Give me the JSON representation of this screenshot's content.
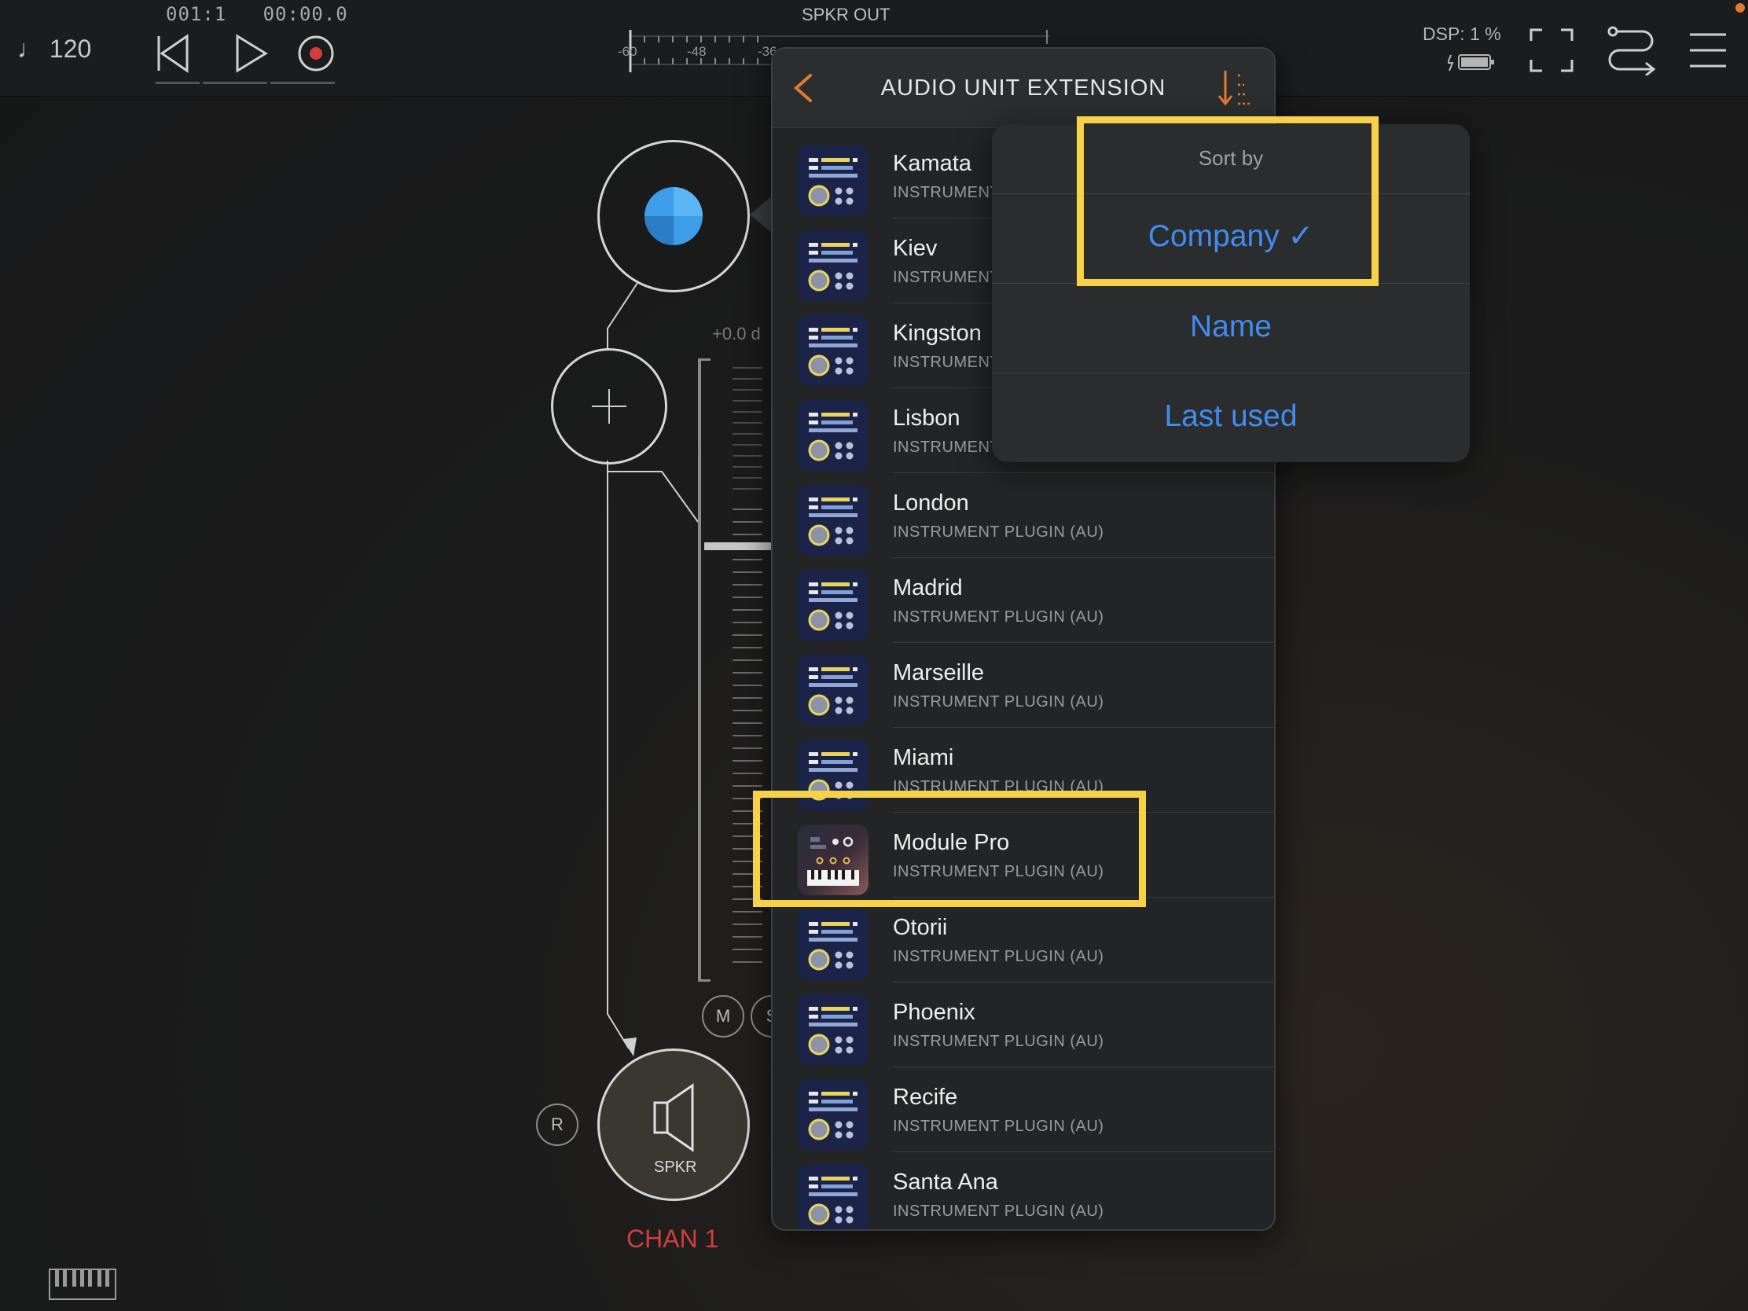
{
  "topbar": {
    "tempo": "♩ 120",
    "position": "001:1",
    "time": "00:00.0",
    "meter_label": "SPKR OUT",
    "meter_ticks": [
      "-60",
      "-48",
      "-36"
    ],
    "meter_peak": "-∞",
    "dsp_label": "DSP:",
    "dsp_value": "1 %"
  },
  "graph": {
    "gain_readout": "+0.0 d",
    "mute_label": "M",
    "solo_label": "S",
    "record_label": "R",
    "speaker_label": "SPKR",
    "channel_label": "CHAN 1"
  },
  "panel": {
    "title": "AUDIO UNIT EXTENSION",
    "items": [
      {
        "name": "Kamata",
        "subtitle": "INSTRUMENT PLUGIN (AU)"
      },
      {
        "name": "Kiev",
        "subtitle": "INSTRUMENT PLUGIN (AU)"
      },
      {
        "name": "Kingston",
        "subtitle": "INSTRUMENT PLUGIN (AU)"
      },
      {
        "name": "Lisbon",
        "subtitle": "INSTRUMENT PLUGIN (AU)"
      },
      {
        "name": "London",
        "subtitle": "INSTRUMENT PLUGIN (AU)"
      },
      {
        "name": "Madrid",
        "subtitle": "INSTRUMENT PLUGIN (AU)"
      },
      {
        "name": "Marseille",
        "subtitle": "INSTRUMENT PLUGIN (AU)"
      },
      {
        "name": "Miami",
        "subtitle": "INSTRUMENT PLUGIN (AU)"
      },
      {
        "name": "Module Pro",
        "subtitle": "INSTRUMENT PLUGIN (AU)"
      },
      {
        "name": "Otorii",
        "subtitle": "INSTRUMENT PLUGIN (AU)"
      },
      {
        "name": "Phoenix",
        "subtitle": "INSTRUMENT PLUGIN (AU)"
      },
      {
        "name": "Recife",
        "subtitle": "INSTRUMENT PLUGIN (AU)"
      },
      {
        "name": "Santa Ana",
        "subtitle": "INSTRUMENT PLUGIN (AU)"
      }
    ]
  },
  "sort_popover": {
    "header": "Sort by",
    "options": [
      "Company ✓",
      "Name",
      "Last used"
    ],
    "selected": "Company"
  },
  "colors": {
    "accent_orange": "#e07a2e",
    "ios_blue": "#3f8df2",
    "highlight_yellow": "#f7d248",
    "record_red": "#d23d3d"
  }
}
